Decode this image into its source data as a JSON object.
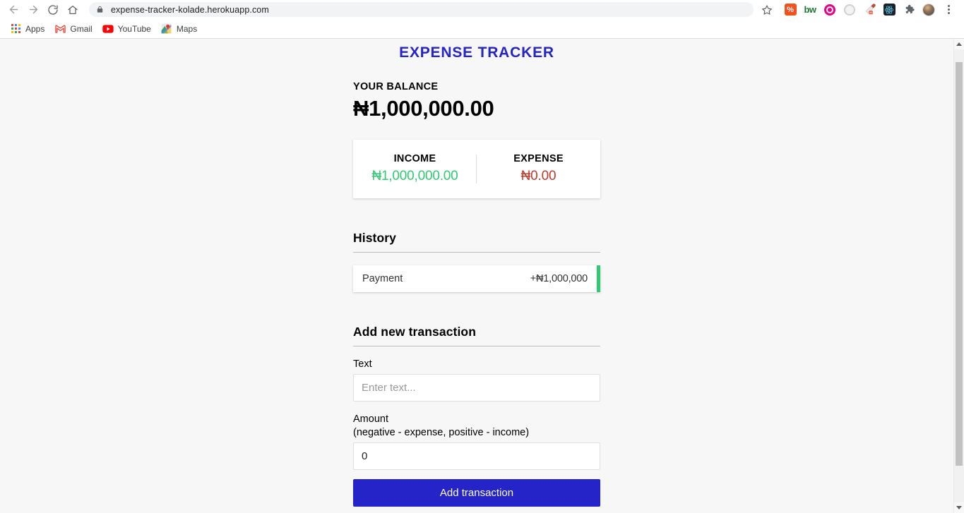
{
  "browser": {
    "back_icon": "back-arrow-icon",
    "forward_icon": "forward-arrow-icon",
    "reload_icon": "reload-icon",
    "home_icon": "home-icon",
    "lock_icon": "lock-icon",
    "url": "expense-tracker-kolade.herokuapp.com",
    "star_icon": "bookmark-star-icon",
    "extensions": [
      {
        "name": "percent-extension-icon",
        "glyph": "%"
      },
      {
        "name": "bitwarden-extension-icon",
        "glyph": "bw"
      },
      {
        "name": "eye-extension-icon",
        "glyph": ""
      },
      {
        "name": "sync-extension-icon",
        "glyph": ""
      },
      {
        "name": "eyedropper-extension-icon",
        "glyph": ""
      },
      {
        "name": "react-devtools-extension-icon",
        "glyph": ""
      },
      {
        "name": "puzzle-extensions-icon",
        "glyph": ""
      }
    ],
    "profile_icon": "profile-avatar-icon",
    "menu_icon": "three-dot-menu-icon",
    "bookmarks": [
      {
        "label": "Apps",
        "icon": "apps-grid-icon"
      },
      {
        "label": "Gmail",
        "icon": "gmail-icon"
      },
      {
        "label": "YouTube",
        "icon": "youtube-icon"
      },
      {
        "label": "Maps",
        "icon": "google-maps-icon"
      }
    ]
  },
  "page": {
    "app_title": "EXPENSE TRACKER",
    "balance": {
      "label": "YOUR BALANCE",
      "amount": "₦1,000,000.00"
    },
    "summary": {
      "income_label": "INCOME",
      "income_amount": "₦1,000,000.00",
      "expense_label": "EXPENSE",
      "expense_amount": "₦0.00"
    },
    "history": {
      "title": "History",
      "items": [
        {
          "text": "Payment",
          "amount": "+₦1,000,000",
          "sign": "plus"
        }
      ]
    },
    "form": {
      "title": "Add new transaction",
      "text_label": "Text",
      "text_value": "",
      "text_placeholder": "Enter text...",
      "amount_label_line1": "Amount",
      "amount_label_line2": "(negative - expense, positive - income)",
      "amount_value": "0",
      "amount_placeholder": "",
      "submit_label": "Add transaction"
    }
  },
  "colors": {
    "brand_blue": "#2424c9",
    "income_green": "#2ecc71",
    "expense_red": "#c0392b",
    "page_bg": "#f7f7f7"
  },
  "scrollbar": {
    "up_arrow": "scroll-up-arrow-icon",
    "down_arrow": "scroll-down-arrow-icon"
  }
}
